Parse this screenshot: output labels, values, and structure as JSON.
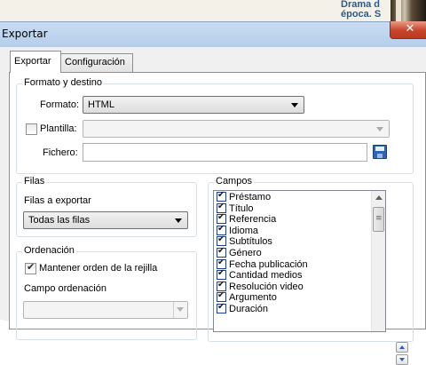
{
  "background": {
    "snippet_line1": "Drama d",
    "snippet_line2": "época. S"
  },
  "window": {
    "title": "Exportar",
    "close_symbol": "✕"
  },
  "tabs": [
    {
      "label": "Exportar",
      "active": true
    },
    {
      "label": "Configuración",
      "active": false
    }
  ],
  "format_group": {
    "title": "Formato y destino",
    "format_label": "Formato:",
    "format_value": "HTML",
    "template_label": "Plantilla:",
    "template_checked": false,
    "template_value": "",
    "file_label": "Fichero:",
    "file_value": "",
    "save_icon": "floppy-disk-icon"
  },
  "rows_group": {
    "title": "Filas",
    "export_label": "Filas a exportar",
    "export_value": "Todas las filas"
  },
  "sort_group": {
    "title": "Ordenación",
    "keep_order_label": "Mantener orden de la rejilla",
    "keep_order_checked": true,
    "sort_field_label": "Campo ordenación",
    "sort_field_value": ""
  },
  "fields_group": {
    "title": "Campos",
    "items": [
      {
        "label": "Préstamo",
        "checked": true
      },
      {
        "label": "Título",
        "checked": true
      },
      {
        "label": "Referencia",
        "checked": true
      },
      {
        "label": "Idioma",
        "checked": true
      },
      {
        "label": "Subtítulos",
        "checked": true
      },
      {
        "label": "Género",
        "checked": true
      },
      {
        "label": "Fecha publicación",
        "checked": true
      },
      {
        "label": "Cantidad medios",
        "checked": true
      },
      {
        "label": "Resolución video",
        "checked": true
      },
      {
        "label": "Argumento",
        "checked": true
      },
      {
        "label": "Duración",
        "checked": true
      }
    ]
  },
  "colors": {
    "titlebar": "#c9dcf3",
    "close_button": "#c7442a",
    "accent": "#2a5bbd"
  }
}
